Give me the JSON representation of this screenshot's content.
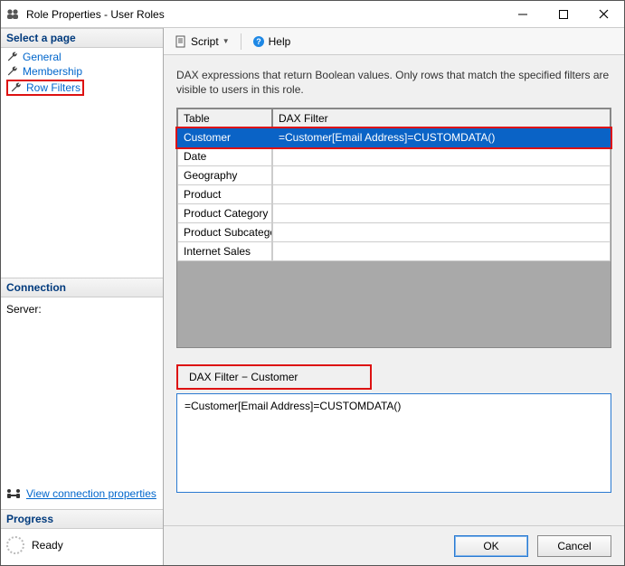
{
  "window": {
    "title": "Role Properties - User Roles"
  },
  "sidebar": {
    "select_header": "Select a page",
    "pages": [
      {
        "label": "General"
      },
      {
        "label": "Membership"
      },
      {
        "label": "Row Filters"
      }
    ],
    "connection_header": "Connection",
    "server_label": "Server:",
    "conn_link": "View connection properties",
    "progress_header": "Progress",
    "progress_status": "Ready"
  },
  "toolbar": {
    "script_label": "Script",
    "help_label": "Help"
  },
  "content": {
    "description": "DAX expressions that return Boolean values. Only rows that match the specified filters are visible to users in this role.",
    "col_table": "Table",
    "col_filter": "DAX Filter",
    "rows": [
      {
        "table": "Customer",
        "filter": "=Customer[Email Address]=CUSTOMDATA()"
      },
      {
        "table": "Date",
        "filter": ""
      },
      {
        "table": "Geography",
        "filter": ""
      },
      {
        "table": "Product",
        "filter": ""
      },
      {
        "table": "Product Category",
        "filter": ""
      },
      {
        "table": "Product Subcategory",
        "filter": ""
      },
      {
        "table": "Internet Sales",
        "filter": ""
      }
    ],
    "dax_label": "DAX Filter − Customer",
    "dax_value": "=Customer[Email Address]=CUSTOMDATA()"
  },
  "buttons": {
    "ok": "OK",
    "cancel": "Cancel"
  }
}
